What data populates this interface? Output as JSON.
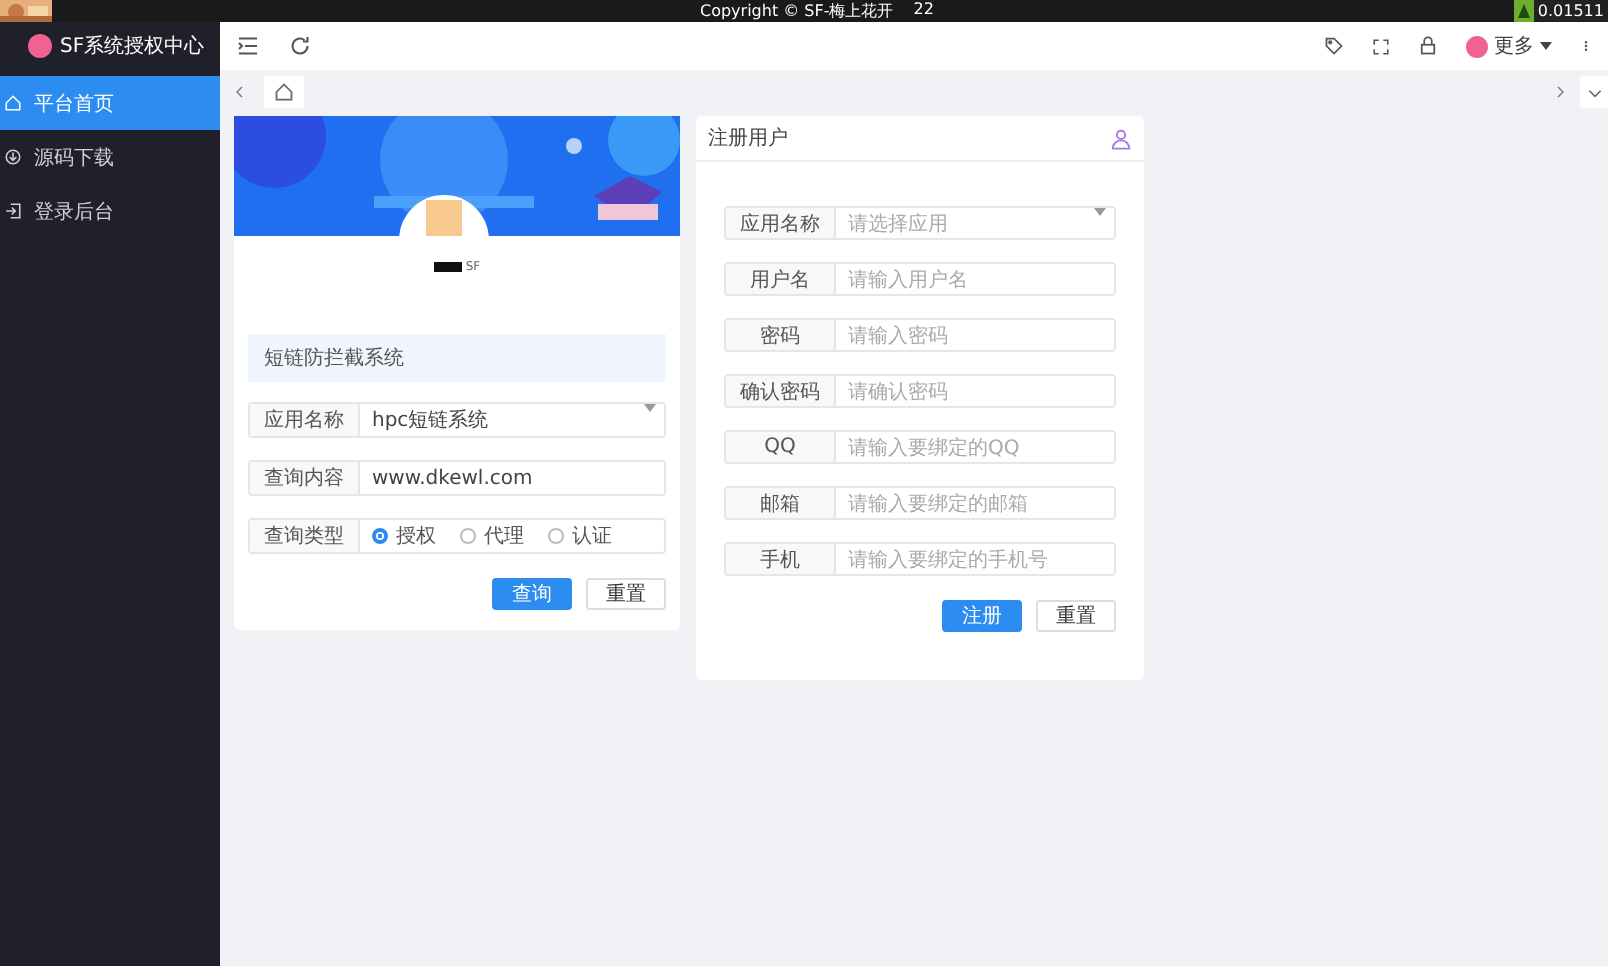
{
  "top_strip": {
    "copyright": "Copyright © SF-梅上花开",
    "number": "22",
    "reading": "0.01511"
  },
  "sidebar": {
    "brand": "SF系统授权中心",
    "items": [
      {
        "label": "平台首页",
        "selected": true
      },
      {
        "label": "源码下载",
        "selected": false
      },
      {
        "label": "登录后台",
        "selected": false
      }
    ]
  },
  "header": {
    "user_menu": "更多"
  },
  "query_card": {
    "site_name": "SF",
    "notice": "短链防拦截系统",
    "fields": [
      {
        "kind": "select",
        "label": "应用名称",
        "value": "hpc短链系统"
      },
      {
        "kind": "input",
        "label": "查询内容",
        "value": "www.dkewl.com"
      },
      {
        "kind": "radio",
        "label": "查询类型",
        "options": [
          {
            "label": "授权",
            "selected": true
          },
          {
            "label": "代理",
            "selected": false
          },
          {
            "label": "认证",
            "selected": false
          }
        ]
      }
    ],
    "buttons": [
      {
        "label": "查询",
        "primary": true
      },
      {
        "label": "重置",
        "primary": false
      }
    ]
  },
  "register_card": {
    "title": "注册用户",
    "fields": [
      {
        "kind": "select",
        "label": "应用名称",
        "placeholder": "请选择应用"
      },
      {
        "kind": "input",
        "label": "用户名",
        "placeholder": "请输入用户名"
      },
      {
        "kind": "input",
        "label": "密码",
        "placeholder": "请输入密码"
      },
      {
        "kind": "input",
        "label": "确认密码",
        "placeholder": "请确认密码"
      },
      {
        "kind": "input",
        "label": "QQ",
        "placeholder": "请输入要绑定的QQ"
      },
      {
        "kind": "input",
        "label": "邮箱",
        "placeholder": "请输入要绑定的邮箱"
      },
      {
        "kind": "input",
        "label": "手机",
        "placeholder": "请输入要绑定的手机号"
      }
    ],
    "buttons": [
      {
        "label": "注册",
        "primary": true
      },
      {
        "label": "重置",
        "primary": false
      }
    ]
  }
}
